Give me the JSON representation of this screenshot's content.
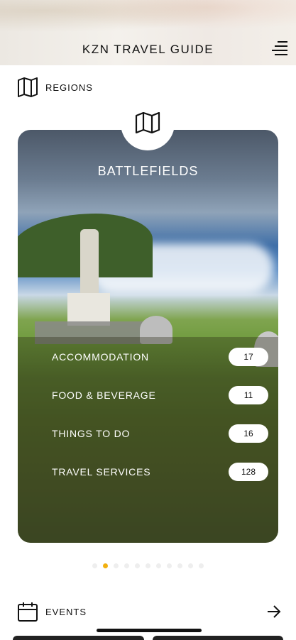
{
  "header": {
    "title": "KZN TRAVEL GUIDE",
    "menu_icon": "hamburger-menu-icon"
  },
  "regions_section": {
    "label": "REGIONS",
    "icon": "map-icon"
  },
  "card": {
    "title": "BATTLEFIELDS",
    "icon": "map-icon",
    "rows": [
      {
        "label": "ACCOMMODATION",
        "count": "17"
      },
      {
        "label": "FOOD & BEVERAGE",
        "count": "11"
      },
      {
        "label": "THINGS TO DO",
        "count": "16"
      },
      {
        "label": "TRAVEL SERVICES",
        "count": "128"
      }
    ]
  },
  "pagination": {
    "total": 11,
    "active_index": 1,
    "active_color": "#f1b00f"
  },
  "events_section": {
    "label": "EVENTS",
    "icon": "calendar-icon",
    "arrow_icon": "arrow-right-icon"
  }
}
